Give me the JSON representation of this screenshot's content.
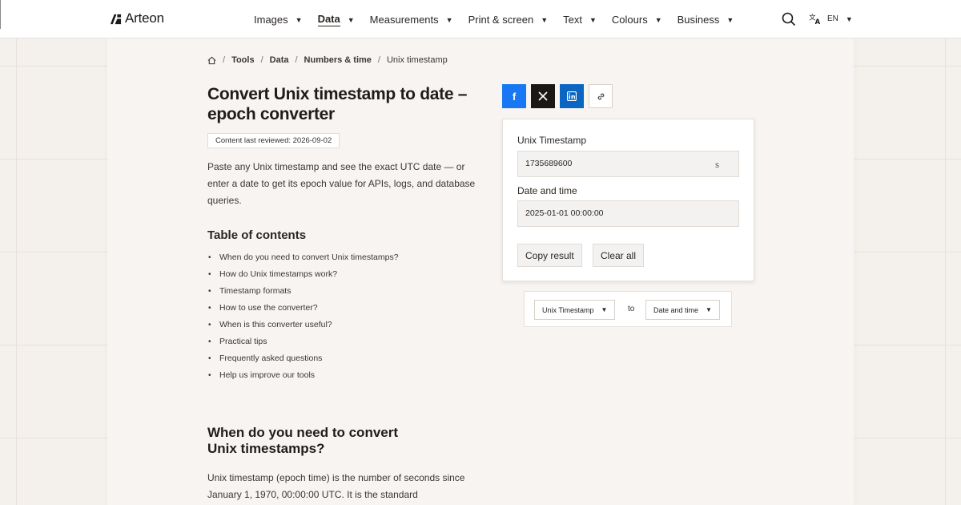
{
  "brand": {
    "name": "Arteon"
  },
  "nav": {
    "items": [
      {
        "label": "Images"
      },
      {
        "label": "Data"
      },
      {
        "label": "Measurements"
      },
      {
        "label": "Print & screen"
      },
      {
        "label": "Text"
      },
      {
        "label": "Colours"
      },
      {
        "label": "Business"
      }
    ],
    "active": "Data",
    "language": "EN"
  },
  "breadcrumb": {
    "items": [
      "Tools",
      "Data",
      "Numbers & time"
    ],
    "current": "Unix timestamp"
  },
  "page": {
    "title": "Convert Unix timestamp to date – epoch converter",
    "reviewed": "Content last reviewed: 2026-09-02",
    "intro": "Paste any Unix timestamp and see the exact UTC date — or enter a date to get its epoch value for APIs, logs, and database queries.",
    "toc_title": "Table of contents",
    "toc": [
      "When do you need to convert Unix timestamps?",
      "How do Unix timestamps work?",
      "Timestamp formats",
      "How to use the converter?",
      "When is this converter useful?",
      "Practical tips",
      "Frequently asked questions",
      "Help us improve our tools"
    ],
    "section_title": "When do you need to convert Unix timestamps?",
    "section_body": "Unix timestamp (epoch time) is the number of seconds since January 1, 1970, 00:00:00 UTC. It is the standard"
  },
  "converter": {
    "timestamp_label": "Unix Timestamp",
    "timestamp_value": "1735689600",
    "timestamp_unit": "s",
    "date_label": "Date and time",
    "date_value": "2025-01-01 00:00:00",
    "copy_label": "Copy result",
    "clear_label": "Clear all"
  },
  "selector": {
    "from": "Unix Timestamp",
    "to_word": "to",
    "to": "Date and time"
  },
  "colors": {
    "facebook": "#1877f2",
    "x": "#1a1716",
    "linkedin": "#0a66c2",
    "background": "#f4f0ec"
  }
}
